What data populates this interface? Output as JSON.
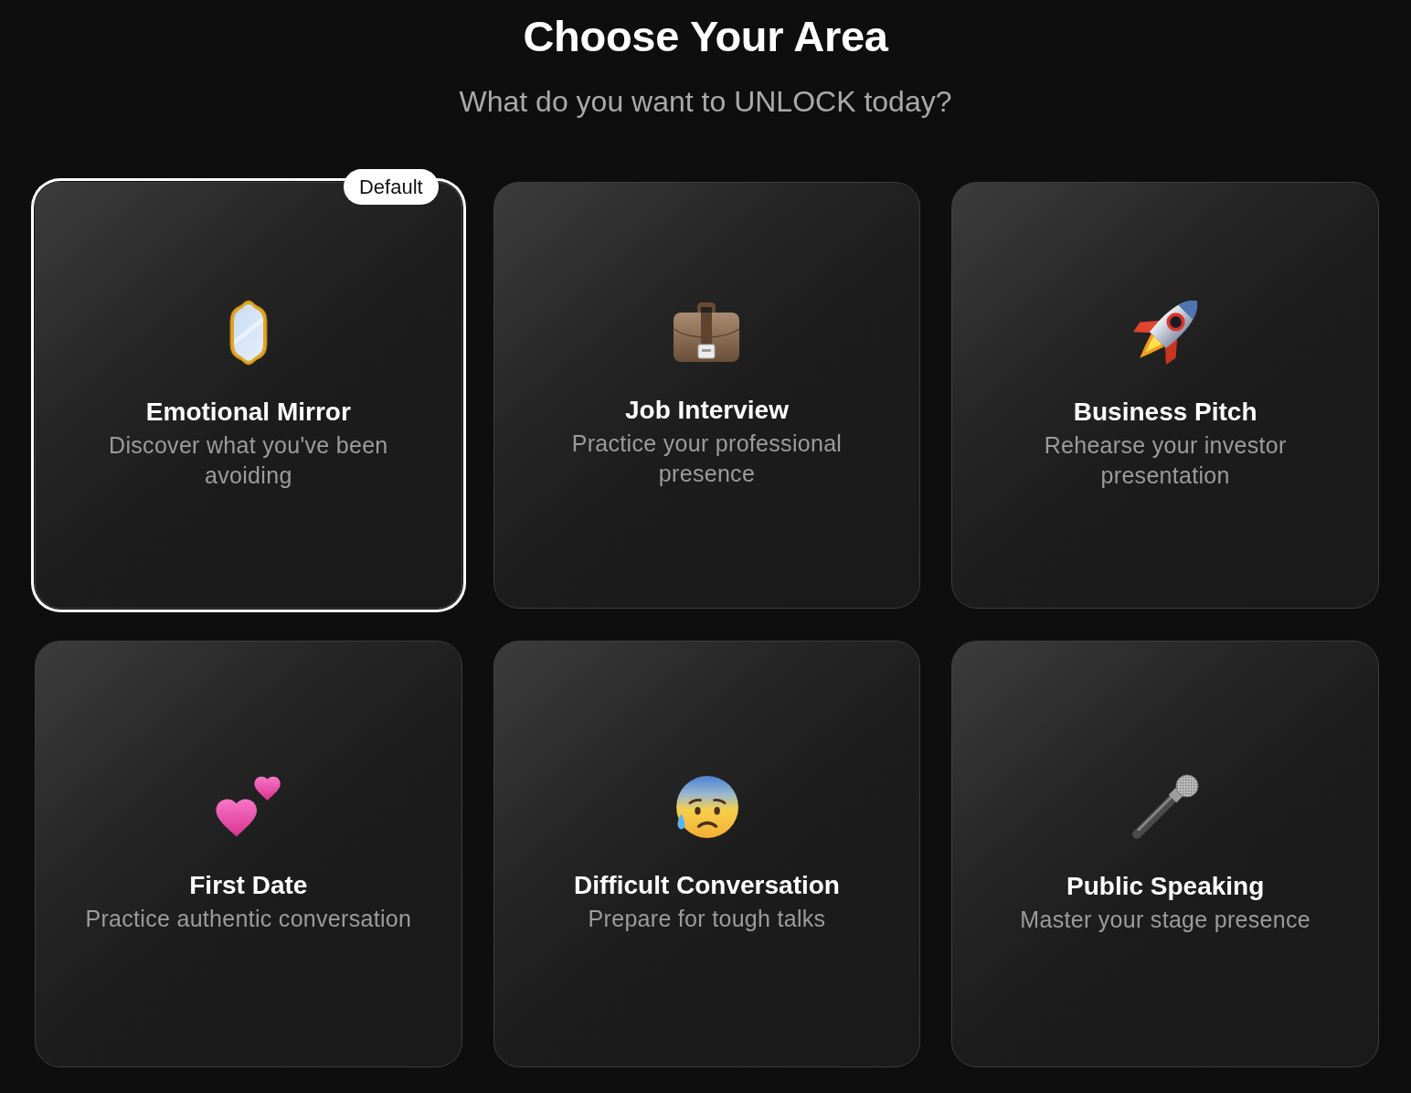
{
  "header": {
    "title": "Choose Your Area",
    "subtitle": "What do you want to UNLOCK today?"
  },
  "areas": [
    {
      "title": "Emotional Mirror",
      "description": "Discover what you've been avoiding",
      "selected": true,
      "badge": "Default"
    },
    {
      "title": "Job Interview",
      "description": "Practice your professional presence",
      "selected": false
    },
    {
      "title": "Business Pitch",
      "description": "Rehearse your investor presentation",
      "selected": false
    },
    {
      "title": "First Date",
      "description": "Practice authentic conversation",
      "selected": false
    },
    {
      "title": "Difficult Conversation",
      "description": "Prepare for tough talks",
      "selected": false
    },
    {
      "title": "Public Speaking",
      "description": "Master your stage presence",
      "selected": false
    }
  ]
}
